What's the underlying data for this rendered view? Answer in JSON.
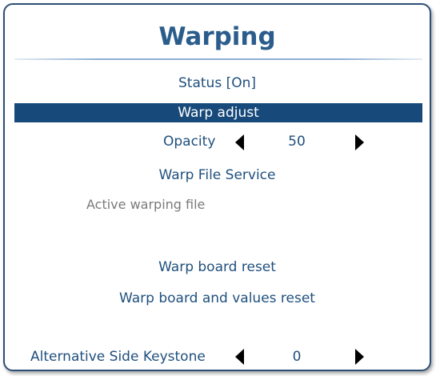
{
  "title": "Warping",
  "menu": {
    "status": "Status [On]",
    "warp_adjust": "Warp adjust",
    "opacity": {
      "label": "Opacity",
      "value": "50"
    },
    "warp_file_service": "Warp File Service",
    "active_warping_file": "Active warping file",
    "warp_board_reset": "Warp board reset",
    "warp_board_values_reset": "Warp board and values reset",
    "alt_side_keystone": {
      "label": "Alternative Side Keystone",
      "value": "0"
    }
  },
  "colors": {
    "title": "#2a5d8c",
    "text": "#1f4f7d",
    "highlight": "#174a7a",
    "disabled": "#7a7a7a",
    "frame": "#2d4f75"
  },
  "icons": [
    "arrow-left-icon",
    "arrow-right-icon"
  ]
}
